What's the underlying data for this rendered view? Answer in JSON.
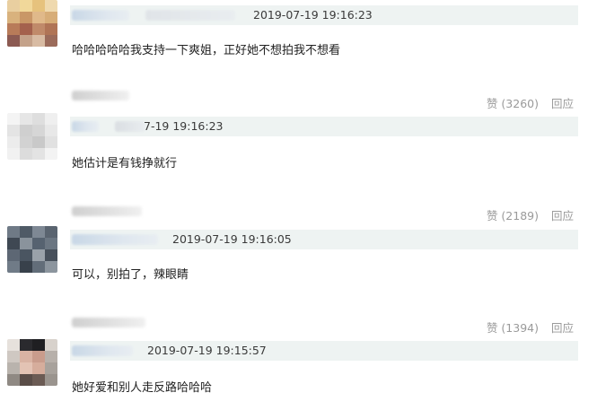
{
  "comments": [
    {
      "timestamp": "2019-07-19 19:16:23",
      "text": "哈哈哈哈哈我支持一下爽姐，正好她不想拍我不想看"
    },
    {
      "timestamp": "7-19 19:16:23",
      "text": "她估计是有钱挣就行",
      "likes_label": "赞 (3260)",
      "reply_label": "回应"
    },
    {
      "timestamp": "2019-07-19 19:16:05",
      "text": "可以，别拍了，辣眼睛",
      "likes_label": "赞 (2189)",
      "reply_label": "回应"
    },
    {
      "timestamp": "2019-07-19 19:15:57",
      "text": "她好爱和别人走反路哈哈哈",
      "likes_label": "赞 (1394)",
      "reply_label": "回应"
    }
  ],
  "colors": {
    "meta_bar_bg": "#eef3f2",
    "action_text": "#9a9a9a",
    "comment_text": "#222222"
  }
}
